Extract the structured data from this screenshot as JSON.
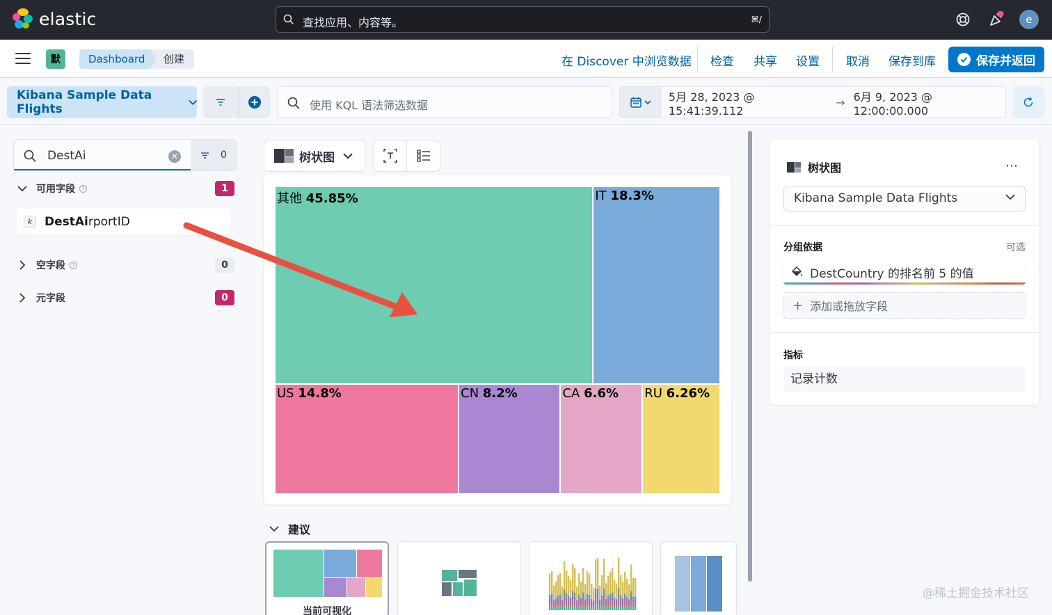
{
  "header": {
    "logo_text": "elastic",
    "search_placeholder": "查找应用、内容等。",
    "search_shortcut": "⌘/",
    "avatar_letter": "e"
  },
  "subbar": {
    "space_badge": "默",
    "breadcrumbs": [
      "Dashboard",
      "创建"
    ],
    "links": {
      "discover": "在 Discover 中浏览数据",
      "inspect": "检查",
      "share": "共享",
      "settings": "设置",
      "cancel": "取消",
      "save_library": "保存到库"
    },
    "save_return": "保存并返回",
    "accent": "#0077cc"
  },
  "querybar": {
    "data_view": "Kibana Sample Data Flights",
    "kql_placeholder": "使用 KQL 语法筛选数据",
    "date_start": "5月 28, 2023 @ 15:41:39.112",
    "date_arrow": "→",
    "date_end": "6月 9, 2023 @ 12:00:00.000"
  },
  "field_list": {
    "search_value": "DestAi",
    "filter_count": "0",
    "groups": [
      {
        "label": "可用字段",
        "count": "1",
        "expanded": true
      },
      {
        "label": "空字段",
        "count": "0",
        "expanded": false
      },
      {
        "label": "元字段",
        "count": "0",
        "expanded": false
      }
    ],
    "field": {
      "type_token": "k",
      "match": "DestAi",
      "rest": "rportID"
    }
  },
  "workspace": {
    "vis_type": "树状图",
    "suggestions_label": "建议",
    "current_vis_label": "当前可视化"
  },
  "chart_data": {
    "type": "treemap",
    "items": [
      {
        "label": "其他",
        "value": 45.85,
        "display": "45.85%",
        "color": "#6dccb1"
      },
      {
        "label": "IT",
        "value": 18.3,
        "display": "18.3%",
        "color": "#79aad9"
      },
      {
        "label": "US",
        "value": 14.8,
        "display": "14.8%",
        "color": "#ee789d"
      },
      {
        "label": "CN",
        "value": 8.2,
        "display": "8.2%",
        "color": "#a987d1"
      },
      {
        "label": "CA",
        "value": 6.6,
        "display": "6.6%",
        "color": "#e4a6c7"
      },
      {
        "label": "RU",
        "value": 6.26,
        "display": "6.26%",
        "color": "#f1d86f"
      }
    ]
  },
  "config": {
    "title": "树状图",
    "data_view": "Kibana Sample Data Flights",
    "group_by_label": "分组依据",
    "optional_label": "可选",
    "dimension": "DestCountry 的排名前 5 的值",
    "add_field": "添加或拖放字段",
    "metric_label": "指标",
    "metric": "记录计数"
  },
  "watermark": "@稀土掘金技术社区"
}
